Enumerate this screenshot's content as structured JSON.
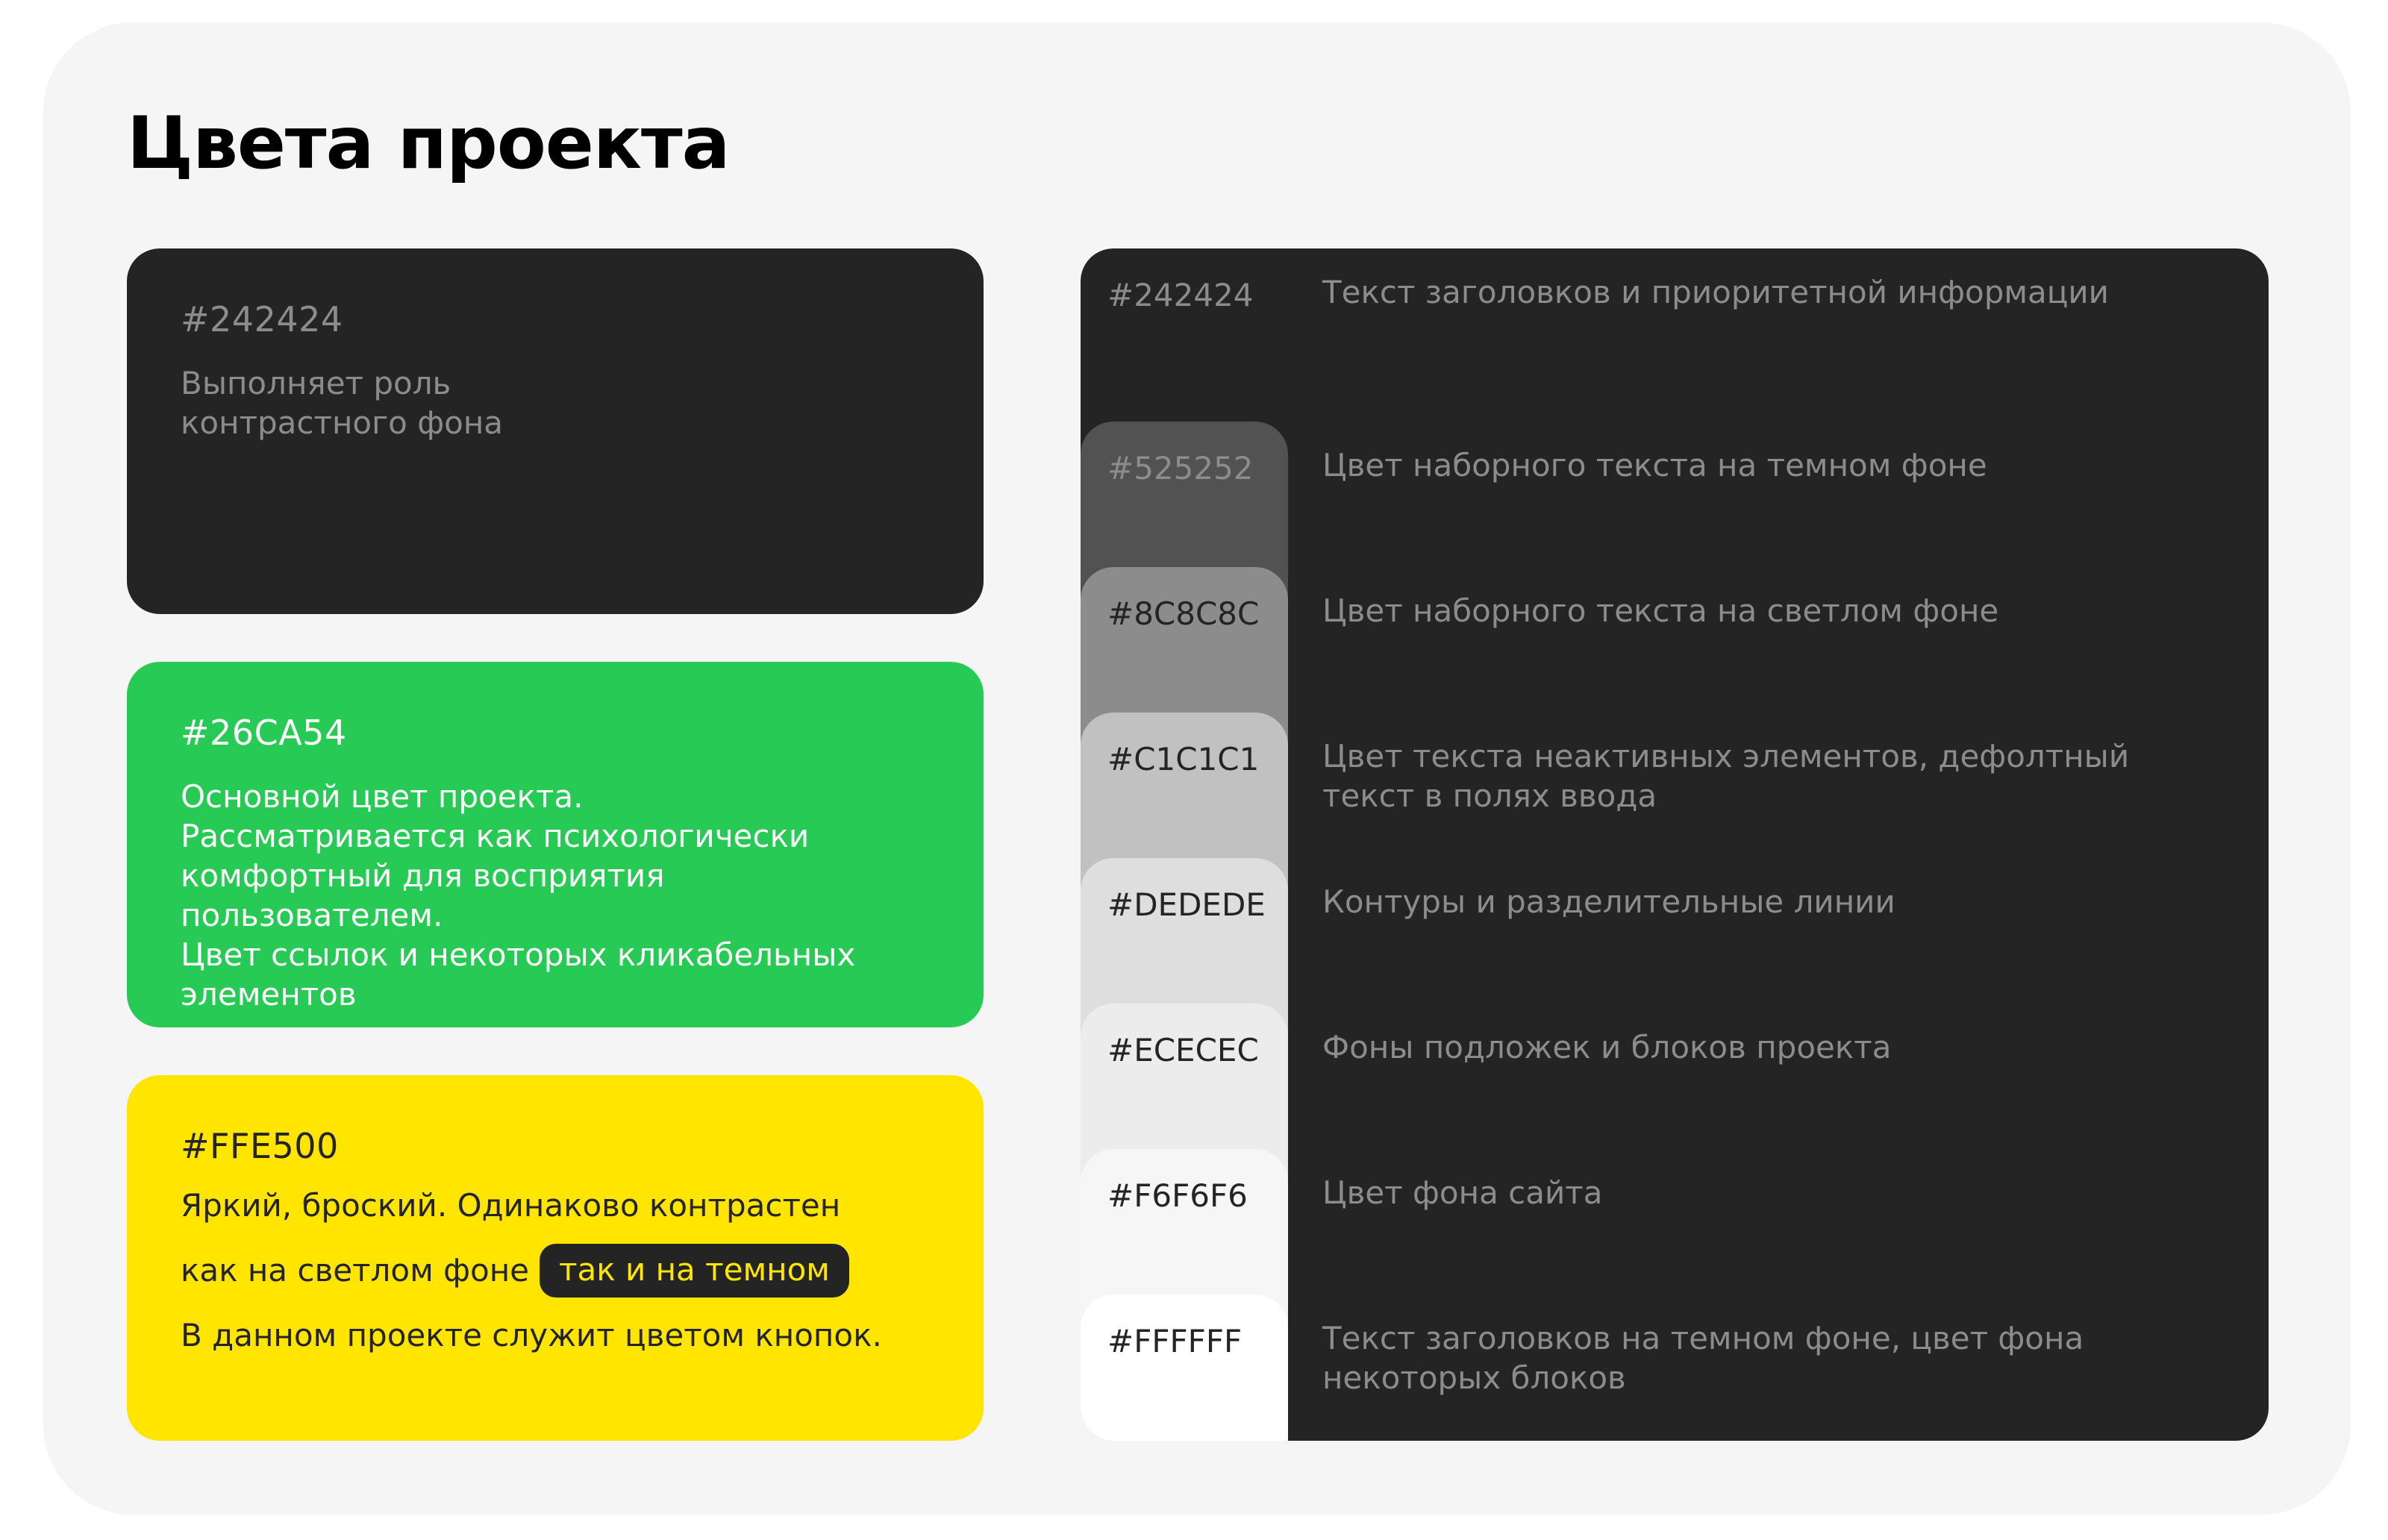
{
  "page": {
    "title": "Цвета проекта"
  },
  "cards": {
    "dark": {
      "hex": "#242424",
      "description": "Выполняет роль\nконтрастного фона",
      "color": "#242424"
    },
    "green": {
      "hex": "#26CA54",
      "description": "Основной цвет проекта.\nРассматривается как психологически\nкомфортный для восприятия пользователем.\nЦвет ссылок и некоторых кликабельных\nэлементов",
      "color": "#26ca54"
    },
    "yellow": {
      "hex": "#FFE500",
      "line1": "Яркий, броский. Одинаково контрастен",
      "line2": "как на светлом фоне",
      "pill": "так и на темном",
      "line3": "В данном проекте служит цветом кнопок.",
      "color": "#ffe500"
    }
  },
  "scale": {
    "rows": [
      {
        "hex": "#242424",
        "description": "Текст заголовков и приоритетной информации",
        "swatch": "#242424",
        "label_color": "#8c8c8c"
      },
      {
        "hex": "#525252",
        "description": "Цвет наборного текста на темном фоне",
        "swatch": "#525252",
        "label_color": "#8c8c8c"
      },
      {
        "hex": "#8C8C8C",
        "description": "Цвет наборного текста на светлом фоне",
        "swatch": "#8c8c8c",
        "label_color": "#242424"
      },
      {
        "hex": "#C1C1C1",
        "description": "Цвет текста неактивных элементов, дефолтный\nтекст в полях ввода",
        "swatch": "#c1c1c1",
        "label_color": "#242424"
      },
      {
        "hex": "#DEDEDE",
        "description": "Контуры и разделительные линии",
        "swatch": "#dedede",
        "label_color": "#242424"
      },
      {
        "hex": "#ECECEC",
        "description": "Фоны подложек и блоков проекта",
        "swatch": "#ececec",
        "label_color": "#242424"
      },
      {
        "hex": "#F6F6F6",
        "description": "Цвет фона сайта",
        "swatch": "#f6f6f6",
        "label_color": "#242424"
      },
      {
        "hex": "#FFFFFF",
        "description": "Текст заголовков на темном фоне, цвет фона\nнекоторых блоков",
        "swatch": "#ffffff",
        "label_color": "#242424"
      }
    ]
  }
}
